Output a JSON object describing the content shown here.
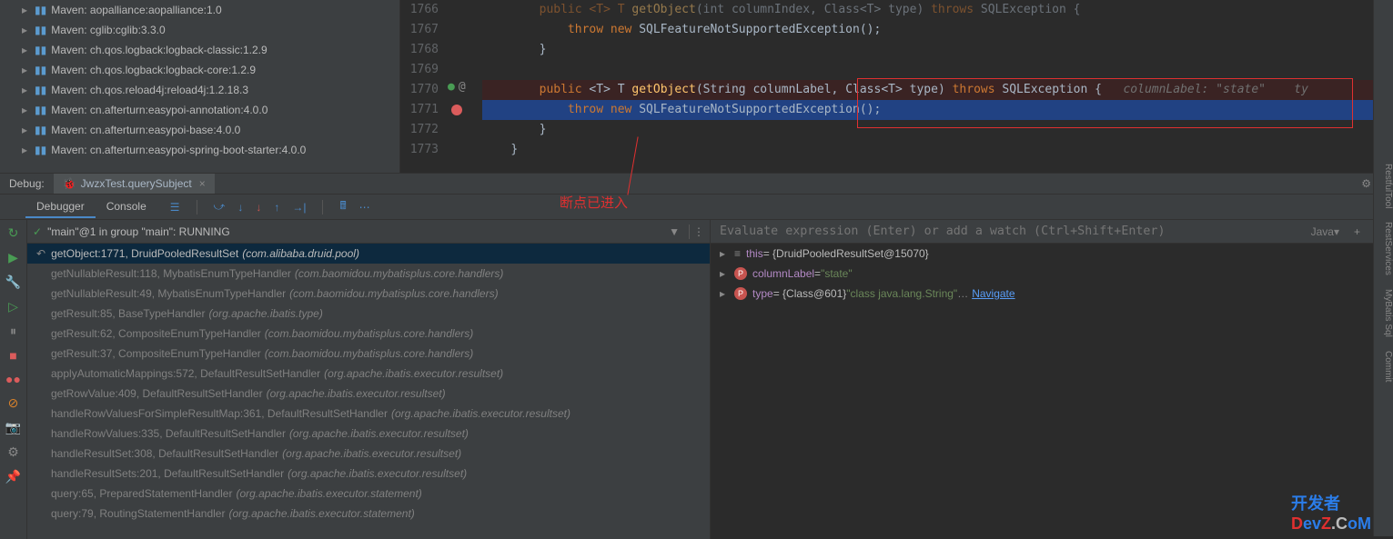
{
  "tree_items": [
    "Maven: aopalliance:aopalliance:1.0",
    "Maven: cglib:cglib:3.3.0",
    "Maven: ch.qos.logback:logback-classic:1.2.9",
    "Maven: ch.qos.logback:logback-core:1.2.9",
    "Maven: ch.qos.reload4j:reload4j:1.2.18.3",
    "Maven: cn.afterturn:easypoi-annotation:4.0.0",
    "Maven: cn.afterturn:easypoi-base:4.0.0",
    "Maven: cn.afterturn:easypoi-spring-boot-starter:4.0.0"
  ],
  "line_numbers": [
    "1766",
    "1767",
    "1768",
    "1769",
    "1770",
    "1771",
    "1772",
    "1773"
  ],
  "code": {
    "l1766_p1": "public <T> T ",
    "l1766_fn": "getObject",
    "l1766_p2": "(int columnIndex, Class<T> type) ",
    "l1766_kw": "throws",
    "l1766_ex": " SQLException {",
    "l1767_kw1": "throw new ",
    "l1767_cls": "SQLFeatureNotSupportedException",
    "l1767_end": "();",
    "l1768": "}",
    "l1770_kw1": "public ",
    "l1770_gen": "<T> T ",
    "l1770_fn": "getObject",
    "l1770_sig": "(String columnLabel, Class<T> type) ",
    "l1770_kw2": "throws",
    "l1770_ex": " SQLException {",
    "l1770_param": "   columnLabel: \"state\"    ty",
    "l1771_kw1": "throw new ",
    "l1771_cls": "SQLFeatureNotSupportedException",
    "l1771_end": "();",
    "l1772": "}",
    "l1773": "}"
  },
  "annotation": "断点已进入",
  "debug_label": "Debug:",
  "tab_name": "JwzxTest.querySubject",
  "tb_tabs": [
    "Debugger",
    "Console"
  ],
  "thread": "\"main\"@1 in group \"main\": RUNNING",
  "frames": [
    {
      "loc": "getObject:1771, DruidPooledResultSet ",
      "pkg": "(com.alibaba.druid.pool)",
      "sel": true
    },
    {
      "loc": "getNullableResult:118, MybatisEnumTypeHandler ",
      "pkg": "(com.baomidou.mybatisplus.core.handlers)"
    },
    {
      "loc": "getNullableResult:49, MybatisEnumTypeHandler ",
      "pkg": "(com.baomidou.mybatisplus.core.handlers)"
    },
    {
      "loc": "getResult:85, BaseTypeHandler ",
      "pkg": "(org.apache.ibatis.type)"
    },
    {
      "loc": "getResult:62, CompositeEnumTypeHandler ",
      "pkg": "(com.baomidou.mybatisplus.core.handlers)"
    },
    {
      "loc": "getResult:37, CompositeEnumTypeHandler ",
      "pkg": "(com.baomidou.mybatisplus.core.handlers)"
    },
    {
      "loc": "applyAutomaticMappings:572, DefaultResultSetHandler ",
      "pkg": "(org.apache.ibatis.executor.resultset)"
    },
    {
      "loc": "getRowValue:409, DefaultResultSetHandler ",
      "pkg": "(org.apache.ibatis.executor.resultset)"
    },
    {
      "loc": "handleRowValuesForSimpleResultMap:361, DefaultResultSetHandler ",
      "pkg": "(org.apache.ibatis.executor.resultset)"
    },
    {
      "loc": "handleRowValues:335, DefaultResultSetHandler ",
      "pkg": "(org.apache.ibatis.executor.resultset)"
    },
    {
      "loc": "handleResultSet:308, DefaultResultSetHandler ",
      "pkg": "(org.apache.ibatis.executor.resultset)"
    },
    {
      "loc": "handleResultSets:201, DefaultResultSetHandler ",
      "pkg": "(org.apache.ibatis.executor.resultset)"
    },
    {
      "loc": "query:65, PreparedStatementHandler ",
      "pkg": "(org.apache.ibatis.executor.statement)"
    },
    {
      "loc": "query:79, RoutingStatementHandler ",
      "pkg": "(org.apache.ibatis.executor.statement)"
    }
  ],
  "eval_placeholder": "Evaluate expression (Enter) or add a watch (Ctrl+Shift+Enter)",
  "lang": "Java",
  "vars": [
    {
      "icon": "eq",
      "name": "this",
      "val": " = {DruidPooledResultSet@15070}"
    },
    {
      "icon": "p",
      "name": "columnLabel",
      "val": " = ",
      "str": "\"state\""
    },
    {
      "icon": "p",
      "name": "type",
      "val": " = {Class@601} ",
      "str": "\"class java.lang.String\"",
      "link": "Navigate",
      "ellipsis": "… "
    }
  ],
  "rightbar": [
    "RestfulTool",
    "RestServices",
    "MyBatis Sql",
    "Commit"
  ],
  "watermark_l1": "开发者",
  "watermark_l2": {
    "d": "D",
    "ev": "ev",
    "z": "Z",
    "dot": ".",
    "c": "C",
    "om": "oM"
  }
}
